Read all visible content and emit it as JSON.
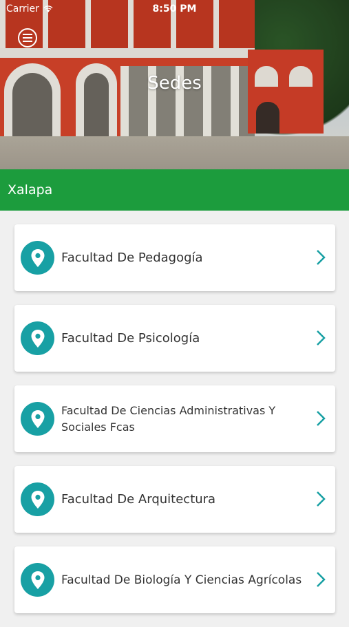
{
  "status_bar": {
    "carrier": "Carrier",
    "time": "8:50 PM"
  },
  "header": {
    "title": "Sedes",
    "menu_icon": "hamburger-menu-icon"
  },
  "section": {
    "label": "Xalapa",
    "color": "#1c9c3d"
  },
  "accent_color": "#18a0a4",
  "items": [
    {
      "label": "Facultad De Pedagogía",
      "icon": "location-pin-icon"
    },
    {
      "label": "Facultad De Psicología",
      "icon": "location-pin-icon"
    },
    {
      "label": "Facultad De Ciencias Administrativas Y Sociales Fcas",
      "icon": "location-pin-icon"
    },
    {
      "label": "Facultad De Arquitectura",
      "icon": "location-pin-icon"
    },
    {
      "label": "Facultad De Biología Y Ciencias Agrícolas",
      "icon": "location-pin-icon"
    }
  ]
}
